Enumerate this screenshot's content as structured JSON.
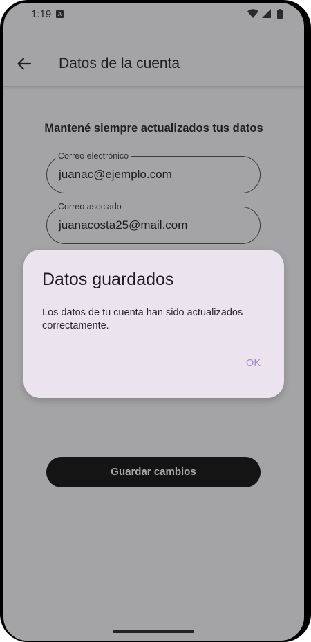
{
  "status_bar": {
    "time": "1:19",
    "notification_icon": "a-icon",
    "icons": [
      "wifi-icon",
      "signal-icon",
      "battery-icon"
    ]
  },
  "app_bar": {
    "back_icon": "arrow-back-icon",
    "title": "Datos de la cuenta"
  },
  "main": {
    "subtitle": "Mantené siempre actualizados tus datos",
    "fields": [
      {
        "label": "Correo electrónico",
        "value": "juanac@ejemplo.com"
      },
      {
        "label": "Correo asociado",
        "value": "juanacosta25@mail.com"
      }
    ],
    "save_button": "Guardar cambios"
  },
  "dialog": {
    "title": "Datos guardados",
    "message": "Los datos de tu cuenta han sido actualizados correctamente.",
    "ok_label": "OK"
  },
  "colors": {
    "scrim_background": "#a4a3a5",
    "dialog_background": "#ebe4ee",
    "accent": "#a189c9",
    "button_background": "#141414"
  }
}
